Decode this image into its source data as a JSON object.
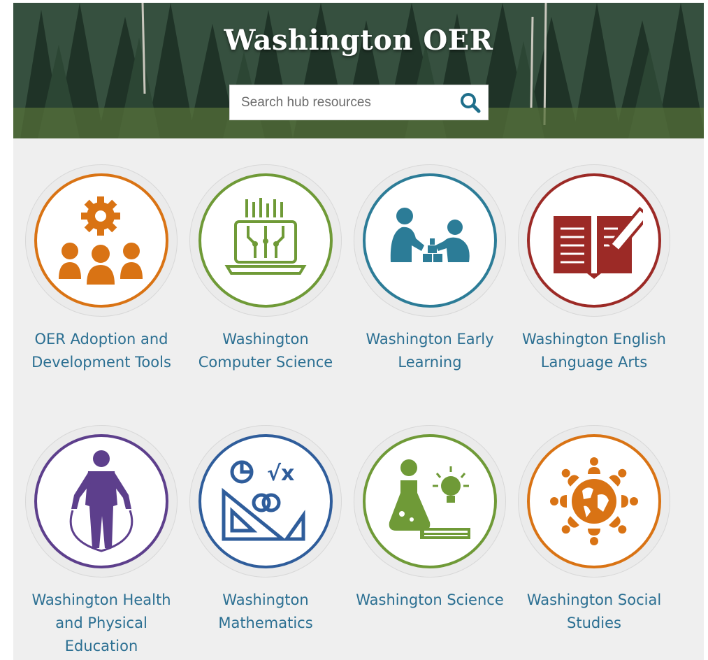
{
  "hero": {
    "title": "Washington OER",
    "search": {
      "placeholder": "Search hub resources",
      "value": "",
      "icon": "search-icon"
    }
  },
  "hubs": [
    {
      "label": "OER Adoption and Development Tools",
      "icon": "team-gear-icon",
      "color": "#d97314"
    },
    {
      "label": "Washington Computer Science",
      "icon": "circuit-laptop-icon",
      "color": "#6f9a37"
    },
    {
      "label": "Washington Early Learning",
      "icon": "children-playing-blocks-icon",
      "color": "#2c7c97"
    },
    {
      "label": "Washington English Language Arts",
      "icon": "open-book-pencil-icon",
      "color": "#9c2a26"
    },
    {
      "label": "Washington Health and Physical Education",
      "icon": "jump-rope-person-icon",
      "color": "#5d3f8c"
    },
    {
      "label": "Washington Mathematics",
      "icon": "math-tools-icon",
      "color": "#2f5d9b"
    },
    {
      "label": "Washington Science",
      "icon": "flask-lightbulb-book-icon",
      "color": "#6f9a37"
    },
    {
      "label": "Washington Social Studies",
      "icon": "globe-people-icon",
      "color": "#d97314"
    }
  ]
}
